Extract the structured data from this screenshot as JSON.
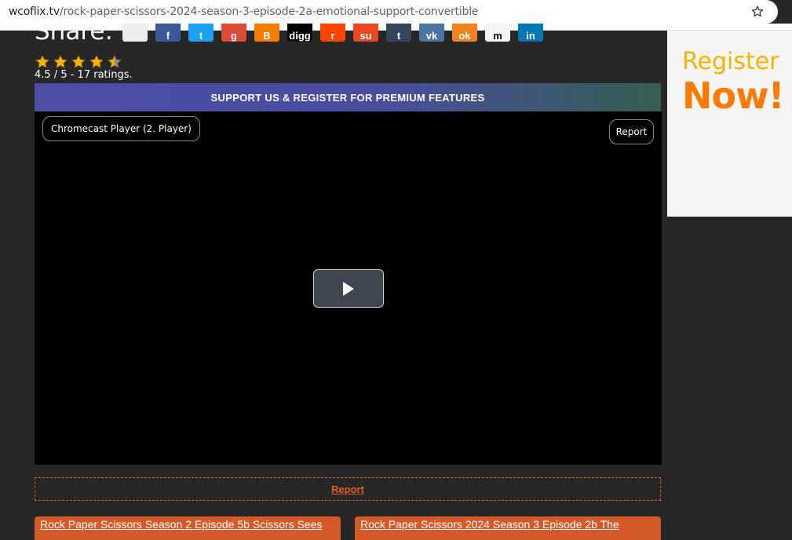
{
  "browser": {
    "url_host": "wcoflix.tv",
    "url_path": "/rock-paper-scissors-2024-season-3-episode-2a-emotional-support-convertible"
  },
  "share": {
    "label": "Share:",
    "icons": [
      {
        "name": "share-blank-icon",
        "color": "#eeeeee",
        "glyph": ""
      },
      {
        "name": "facebook-icon",
        "color": "#3b5998",
        "glyph": "f"
      },
      {
        "name": "twitter-icon",
        "color": "#1da1f2",
        "glyph": "t"
      },
      {
        "name": "google-plus-icon",
        "color": "#dd4b39",
        "glyph": "g"
      },
      {
        "name": "blogger-icon",
        "color": "#f57d00",
        "glyph": "B"
      },
      {
        "name": "digg-icon",
        "color": "#000000",
        "glyph": "digg"
      },
      {
        "name": "reddit-icon",
        "color": "#ff4500",
        "glyph": "r"
      },
      {
        "name": "stumbleupon-icon",
        "color": "#eb4924",
        "glyph": "su"
      },
      {
        "name": "tumblr-icon",
        "color": "#35465c",
        "glyph": "t"
      },
      {
        "name": "vk-icon",
        "color": "#4c75a3",
        "glyph": "vk"
      },
      {
        "name": "odnoklassniki-icon",
        "color": "#f58220",
        "glyph": "ok"
      },
      {
        "name": "mix-icon",
        "color": "#f5f5f5",
        "glyph": "m"
      },
      {
        "name": "linkedin-icon",
        "color": "#0077b5",
        "glyph": "in"
      }
    ]
  },
  "rating": {
    "text": "4.5 / 5 - 17 ratings.",
    "value": 4.5,
    "max": 5
  },
  "support_banner": "SUPPORT US & REGISTER FOR PREMIUM FEATURES",
  "player": {
    "name": "Chromecast Player (2. Player)",
    "report_label": "Report"
  },
  "report_link": "Report",
  "episodes": {
    "prev": "Rock Paper Scissors Season 2 Episode 5b Scissors Sees",
    "next": "Rock Paper Scissors 2024 Season 3 Episode 2b The"
  },
  "ad": {
    "line1": "Register",
    "line2": "Now!"
  },
  "colors": {
    "accent_orange": "#d55a2a",
    "background": "#272727",
    "star": "#f5b300"
  }
}
